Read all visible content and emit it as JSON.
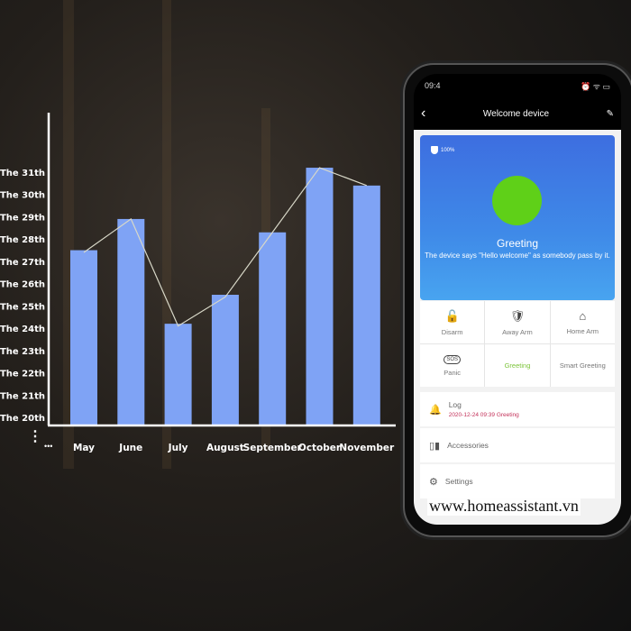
{
  "chart_data": {
    "type": "bar",
    "categories": [
      "May",
      "June",
      "July",
      "August",
      "September",
      "October",
      "November"
    ],
    "values": [
      27.5,
      28.9,
      24.2,
      25.5,
      28.3,
      31.2,
      30.4
    ],
    "overlay_line": {
      "values": [
        27.4,
        28.9,
        24.1,
        25.4,
        28.3,
        31.2,
        30.4
      ],
      "color": "#d8d8c8"
    },
    "y_tick_labels": [
      "The 20th",
      "The 21th",
      "The 22th",
      "The 23th",
      "The 24th",
      "The 25th",
      "The 26th",
      "The 27th",
      "The 28th",
      "The 29th",
      "The 30th",
      "The 31th"
    ],
    "ylim": [
      20,
      31
    ],
    "bar_color": "#7fa3f5",
    "grid": false,
    "title": "",
    "xlabel": "",
    "ylabel": ""
  },
  "axis_marks": {
    "more_x": "•••",
    "more_y": "⋮"
  },
  "phone": {
    "status": {
      "time": "09:4",
      "icons": "⏰ ᯤ ▭"
    },
    "nav": {
      "back": "‹",
      "title": "Welcome device",
      "edit": "✎"
    },
    "hero": {
      "battery": "100%",
      "title": "Greeting",
      "description": "The device says \"Hello welcome\" as somebody pass by it.",
      "circle_color": "#5fd018"
    },
    "modes": [
      {
        "label": "Disarm",
        "icon": "🔓",
        "icon_name": "unlock-icon"
      },
      {
        "label": "Away Arm",
        "icon": "🛡",
        "icon_name": "shield-check-icon"
      },
      {
        "label": "Home Arm",
        "icon": "⌂",
        "icon_name": "home-icon"
      },
      {
        "label": "Panic",
        "icon": "SOS",
        "icon_name": "sos-icon"
      },
      {
        "label": "Greeting",
        "active": true,
        "color": "#7cc43a"
      },
      {
        "label": "Smart Greeting"
      }
    ],
    "list": {
      "log": {
        "label": "Log",
        "sub": "2020-12-24 09:39 Greeting",
        "icon": "🔔"
      },
      "accessories": {
        "label": "Accessories",
        "icon": "▯▮"
      },
      "settings": {
        "label": "Settings",
        "icon": "⚙"
      }
    }
  },
  "watermark": "www.homeassistant.vn"
}
